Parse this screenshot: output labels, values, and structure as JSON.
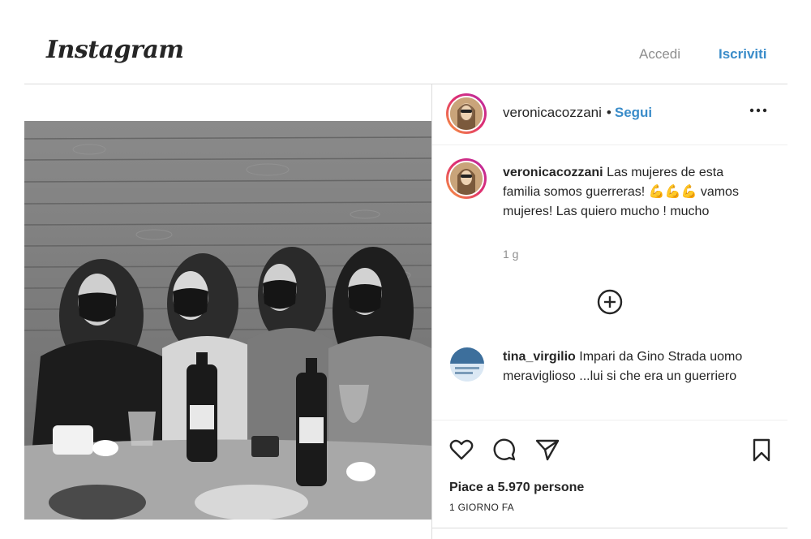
{
  "header": {
    "logo": "Instagram",
    "login_label": "Accedi",
    "signup_label": "Iscriviti"
  },
  "post": {
    "username": "veronicacozzani",
    "separator": "•",
    "follow_label": "Segui",
    "more_icon": "more-horizontal-icon",
    "caption_username": "veronicacozzani",
    "caption_text": "Las mujeres de esta familia somos guerreras! 💪💪💪 vamos mujeres! Las quiero mucho ! mucho",
    "caption_time": "1 g",
    "load_more_icon": "plus-circle-icon"
  },
  "comment": {
    "username": "tina_virgilio",
    "text": "Impari da Gino Strada uomo meraviglioso ...lui si che era un guerriero"
  },
  "actions": {
    "likes_text": "Piace a 5.970 persone",
    "time_ago": "1 GIORNO FA",
    "icons": [
      "heart-icon",
      "comment-icon",
      "share-icon",
      "bookmark-icon"
    ]
  },
  "colors": {
    "accent": "#3a8cc9",
    "muted": "#8e8e8e",
    "text": "#262626"
  }
}
